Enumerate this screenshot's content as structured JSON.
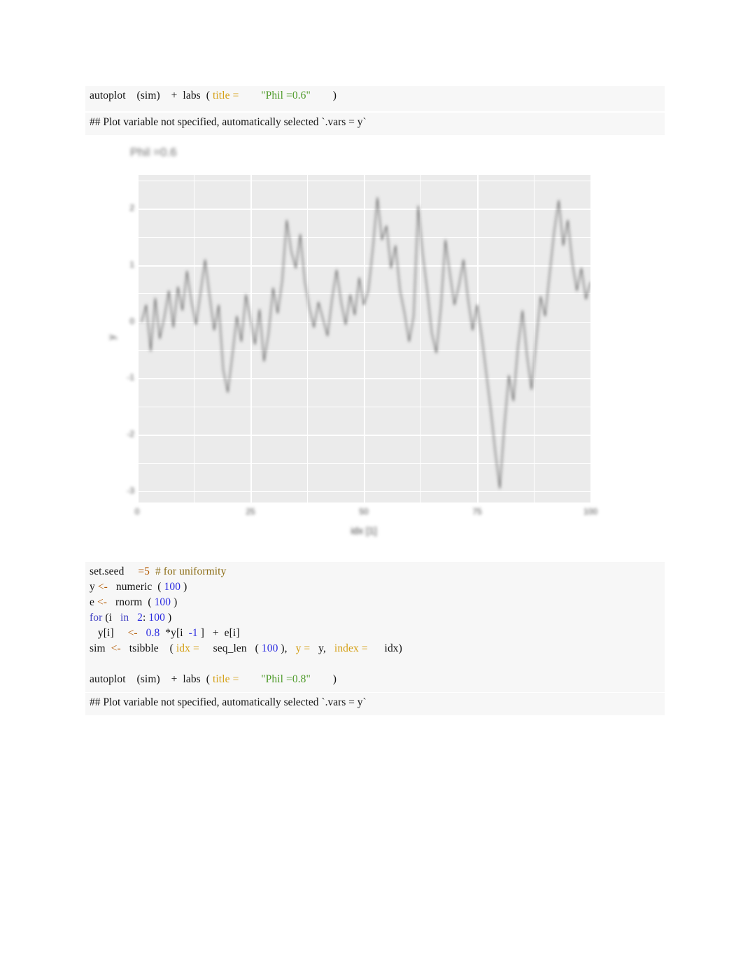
{
  "document": {
    "type": "r-markdown-knitted-output",
    "page_background": "#ffffff",
    "code_background": "#f7f7f7"
  },
  "colors": {
    "string": "#4d9a28",
    "argument": "#d4a017",
    "number": "#2a2ae0",
    "keyword": "#4343c4",
    "assign": "#b35900",
    "comment": "#8c6d16",
    "panel": "#ebebeb",
    "gridline": "#ffffff",
    "series": "#595959"
  },
  "chunk_top": {
    "lines": [
      [
        {
          "t": "autoplot",
          "c": "plain"
        },
        {
          "t": "    ",
          "c": "plain"
        },
        {
          "t": "(sim)",
          "c": "plain"
        },
        {
          "t": "    ",
          "c": "plain"
        },
        {
          "t": "+  labs  (",
          "c": "plain"
        },
        {
          "t": " title =",
          "c": "arg"
        },
        {
          "t": "        ",
          "c": "plain"
        },
        {
          "t": "\"Phil =0.6\"",
          "c": "str"
        },
        {
          "t": "        )",
          "c": "plain"
        }
      ]
    ]
  },
  "output_top": {
    "text": "## Plot variable not specified, automatically selected `.vars = y`"
  },
  "chart_data": {
    "type": "line",
    "title": "Phil =0.6",
    "xlabel": "idx [1]",
    "ylabel": "y",
    "grid": true,
    "legend": "none",
    "xlim": [
      0,
      100
    ],
    "ylim": [
      -3.2,
      2.6
    ],
    "xticks": [
      0,
      25,
      50,
      75,
      100
    ],
    "xticklabels": [
      "0",
      "25",
      "50",
      "75",
      "100"
    ],
    "yticks": [
      -3,
      -2,
      -1,
      0,
      1,
      2
    ],
    "yticklabels": [
      "-3",
      "-2",
      "-1",
      "0",
      "1",
      "2"
    ],
    "x": [
      1,
      2,
      3,
      4,
      5,
      6,
      7,
      8,
      9,
      10,
      11,
      12,
      13,
      14,
      15,
      16,
      17,
      18,
      19,
      20,
      21,
      22,
      23,
      24,
      25,
      26,
      27,
      28,
      29,
      30,
      31,
      32,
      33,
      34,
      35,
      36,
      37,
      38,
      39,
      40,
      41,
      42,
      43,
      44,
      45,
      46,
      47,
      48,
      49,
      50,
      51,
      52,
      53,
      54,
      55,
      56,
      57,
      58,
      59,
      60,
      61,
      62,
      63,
      64,
      65,
      66,
      67,
      68,
      69,
      70,
      71,
      72,
      73,
      74,
      75,
      76,
      77,
      78,
      79,
      80,
      81,
      82,
      83,
      84,
      85,
      86,
      87,
      88,
      89,
      90,
      91,
      92,
      93,
      94,
      95,
      96,
      97,
      98,
      99,
      100
    ],
    "values": [
      0.0,
      0.3,
      -0.52,
      0.42,
      -0.3,
      0.08,
      0.55,
      -0.1,
      0.62,
      0.2,
      0.9,
      0.35,
      -0.05,
      0.52,
      1.1,
      0.45,
      -0.15,
      0.3,
      -0.85,
      -1.25,
      -0.6,
      0.1,
      -0.35,
      0.48,
      0.05,
      -0.4,
      0.22,
      -0.7,
      -0.2,
      0.6,
      0.15,
      0.72,
      1.8,
      1.25,
      0.95,
      1.55,
      0.7,
      0.25,
      -0.1,
      0.35,
      0.05,
      -0.25,
      0.4,
      0.92,
      0.35,
      -0.05,
      0.48,
      0.12,
      0.78,
      0.3,
      0.55,
      1.3,
      2.2,
      1.45,
      1.7,
      0.95,
      1.35,
      0.55,
      0.15,
      -0.35,
      0.1,
      2.05,
      1.2,
      0.55,
      -0.2,
      -0.55,
      0.25,
      1.45,
      0.85,
      0.3,
      0.65,
      1.1,
      0.4,
      -0.15,
      0.3,
      -0.25,
      -0.9,
      -1.55,
      -2.3,
      -2.95,
      -1.85,
      -0.95,
      -1.4,
      -0.45,
      0.2,
      -0.6,
      -1.2,
      -0.35,
      0.45,
      0.1,
      0.85,
      1.6,
      2.15,
      1.35,
      1.8,
      1.05,
      0.55,
      0.95,
      0.4,
      0.7
    ]
  },
  "chunk_bottom": {
    "lines": [
      [
        {
          "t": "set.seed",
          "c": "plain"
        },
        {
          "t": "     ",
          "c": "plain"
        },
        {
          "t": "=5",
          "c": "assign"
        },
        {
          "t": "  ",
          "c": "plain"
        },
        {
          "t": "# for uniformity",
          "c": "comment"
        }
      ],
      [
        {
          "t": "y ",
          "c": "plain"
        },
        {
          "t": "<-",
          "c": "assign"
        },
        {
          "t": "   numeric  (",
          "c": "plain"
        },
        {
          "t": " 100",
          "c": "num"
        },
        {
          "t": " )",
          "c": "plain"
        }
      ],
      [
        {
          "t": "e ",
          "c": "plain"
        },
        {
          "t": "<-",
          "c": "assign"
        },
        {
          "t": "   rnorm  (",
          "c": "plain"
        },
        {
          "t": " 100",
          "c": "num"
        },
        {
          "t": " )",
          "c": "plain"
        }
      ],
      [
        {
          "t": "for",
          "c": "kw"
        },
        {
          "t": " (i   ",
          "c": "plain"
        },
        {
          "t": "in",
          "c": "kw"
        },
        {
          "t": "   ",
          "c": "plain"
        },
        {
          "t": "2",
          "c": "num"
        },
        {
          "t": ":",
          "c": "plain"
        },
        {
          "t": " 100",
          "c": "num"
        },
        {
          "t": " )",
          "c": "plain"
        }
      ],
      [
        {
          "t": "   y[i]     ",
          "c": "plain"
        },
        {
          "t": "<-",
          "c": "assign"
        },
        {
          "t": "   ",
          "c": "plain"
        },
        {
          "t": "0.8",
          "c": "num"
        },
        {
          "t": "  *y[i ",
          "c": "plain"
        },
        {
          "t": " -1",
          "c": "num"
        },
        {
          "t": " ]   +  e[i]",
          "c": "plain"
        }
      ],
      [
        {
          "t": "sim  ",
          "c": "plain"
        },
        {
          "t": "<-",
          "c": "assign"
        },
        {
          "t": "   tsibble    (",
          "c": "plain"
        },
        {
          "t": " idx =",
          "c": "arg"
        },
        {
          "t": "     seq_len   (",
          "c": "plain"
        },
        {
          "t": " 100",
          "c": "num"
        },
        {
          "t": " ),   ",
          "c": "plain"
        },
        {
          "t": "y =",
          "c": "arg"
        },
        {
          "t": "   y,   ",
          "c": "plain"
        },
        {
          "t": "index =",
          "c": "arg"
        },
        {
          "t": "      idx)",
          "c": "plain"
        }
      ],
      [
        {
          "t": "",
          "c": "plain"
        }
      ],
      [
        {
          "t": "autoplot",
          "c": "plain"
        },
        {
          "t": "    ",
          "c": "plain"
        },
        {
          "t": "(sim)",
          "c": "plain"
        },
        {
          "t": "    ",
          "c": "plain"
        },
        {
          "t": "+  labs  (",
          "c": "plain"
        },
        {
          "t": " title =",
          "c": "arg"
        },
        {
          "t": "        ",
          "c": "plain"
        },
        {
          "t": "\"Phil =0.8\"",
          "c": "str"
        },
        {
          "t": "        )",
          "c": "plain"
        }
      ]
    ]
  },
  "output_bottom": {
    "text": "## Plot variable not specified, automatically selected `.vars = y`"
  }
}
